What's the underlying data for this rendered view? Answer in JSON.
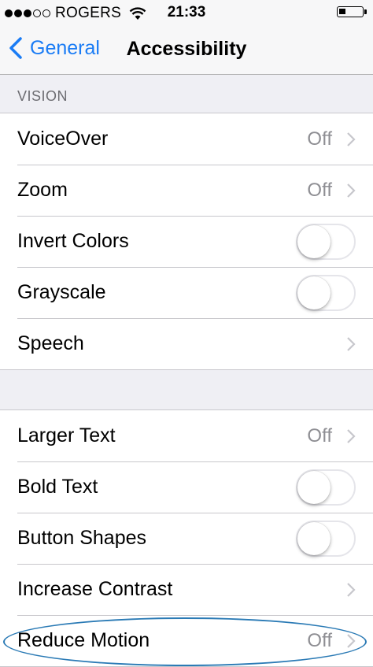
{
  "status_bar": {
    "carrier": "ROGERS",
    "time": "21:33",
    "signal_bars_filled": 3,
    "signal_bars_total": 5,
    "battery_level_fraction": 0.3
  },
  "nav": {
    "back_label": "General",
    "title": "Accessibility"
  },
  "section_vision": {
    "header": "VISION",
    "rows": [
      {
        "label": "VoiceOver",
        "value": "Off",
        "control": "disclosure"
      },
      {
        "label": "Zoom",
        "value": "Off",
        "control": "disclosure"
      },
      {
        "label": "Invert Colors",
        "control": "toggle",
        "on": false
      },
      {
        "label": "Grayscale",
        "control": "toggle",
        "on": false
      },
      {
        "label": "Speech",
        "control": "disclosure"
      }
    ]
  },
  "section_text": {
    "rows": [
      {
        "label": "Larger Text",
        "value": "Off",
        "control": "disclosure"
      },
      {
        "label": "Bold Text",
        "control": "toggle",
        "on": false
      },
      {
        "label": "Button Shapes",
        "control": "toggle",
        "on": false
      },
      {
        "label": "Increase Contrast",
        "control": "disclosure"
      },
      {
        "label": "Reduce Motion",
        "value": "Off",
        "control": "disclosure"
      }
    ]
  },
  "colors": {
    "accent": "#1a7cf5",
    "annotation": "#2a7ab5"
  },
  "icons": [
    "wifi-icon",
    "battery-icon",
    "back-chevron-icon",
    "chevron-right-icon"
  ]
}
